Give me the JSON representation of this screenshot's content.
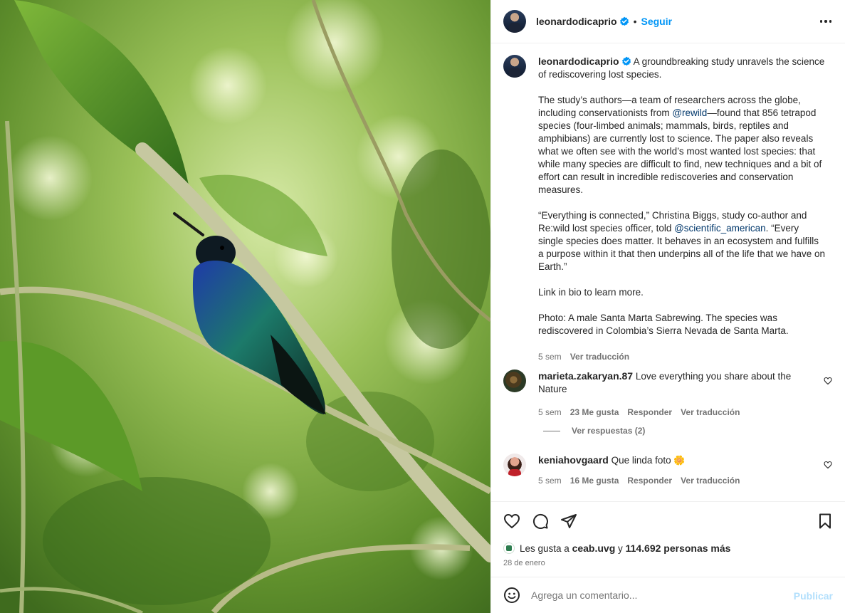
{
  "post": {
    "username": "leonardodicaprio",
    "separator": "•",
    "follow_label": "Seguir",
    "caption_paragraphs": [
      {
        "text": "A groundbreaking study unravels the science of rediscovering lost species."
      },
      {
        "before": "The study’s authors—a team of researchers across the globe, including conservationists from ",
        "mention": "@rewild",
        "after": "—found that 856 tetrapod species (four-limbed animals; mammals, birds, reptiles and amphibians) are currently lost to science. The paper also reveals what we often see with the world’s most wanted lost species: that while many species are difficult to find, new techniques and a bit of effort can result in incredible rediscoveries and conservation measures."
      },
      {
        "before": "“Everything is connected,” Christina Biggs, study co-author and Re:wild lost species officer, told ",
        "mention": "@scientific_american",
        "after": ". “Every single species does matter. It behaves in an ecosystem and fulfills a purpose within it that then underpins all of the life that we have on Earth.”"
      },
      {
        "text": "Link in bio to learn more."
      },
      {
        "text": "Photo: A male Santa Marta Sabrewing. The species was rediscovered in Colombia’s Sierra Nevada de Santa Marta."
      }
    ],
    "caption_age": "5 sem",
    "see_translation": "Ver traducción"
  },
  "comments": [
    {
      "username": "marieta.zakaryan.87",
      "text": "Love everything you share about the Nature",
      "age": "5 sem",
      "likes": "23 Me gusta",
      "reply": "Responder",
      "translate": "Ver traducción",
      "view_replies": "Ver respuestas (2)"
    },
    {
      "username": "keniahovgaard",
      "text": "Que linda foto",
      "emoji": "🌼",
      "age": "5 sem",
      "likes": "16 Me gusta",
      "reply": "Responder",
      "translate": "Ver traducción"
    }
  ],
  "actions": {
    "icons": [
      "heart-icon",
      "comment-icon",
      "share-icon",
      "bookmark-icon"
    ],
    "liked_by_prefix": "Les gusta a",
    "liked_by_user": "ceab.uvg",
    "liked_by_join": "y",
    "liked_by_count": "114.692 personas más",
    "date": "28 de enero"
  },
  "add_comment": {
    "placeholder": "Agrega un comentario...",
    "publish_label": "Publicar"
  },
  "colors": {
    "link": "#0095f6",
    "mention": "#00376b",
    "secondary": "#737373",
    "publish_disabled": "#b2dffc",
    "verified": "#0095f6"
  }
}
